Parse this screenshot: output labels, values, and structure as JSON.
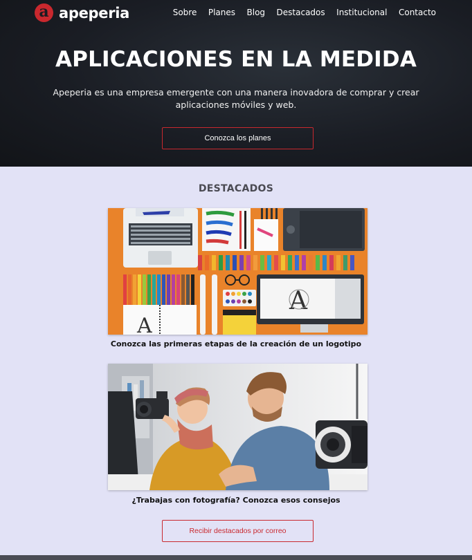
{
  "brand": {
    "name": "apeperia",
    "mark": "a",
    "accent": "#c9282e"
  },
  "nav": {
    "items": [
      {
        "label": "Sobre"
      },
      {
        "label": "Planes"
      },
      {
        "label": "Blog"
      },
      {
        "label": "Destacados"
      },
      {
        "label": "Institucional"
      },
      {
        "label": "Contacto"
      }
    ]
  },
  "hero": {
    "title": "APLICACIONES EN LA MEDIDA",
    "subtitle": "Apeperia es una empresa emergente con una manera inovadora de comprar y crear aplicaciones móviles y web.",
    "cta_label": "Conozca los planes"
  },
  "featured": {
    "title": "DESTACADOS",
    "cards": [
      {
        "caption": "Conozca las primeras etapas de la creación de un logotipo",
        "image": "design-tools-flatlay-illustration"
      },
      {
        "caption": "¿Trabajas con fotografía? Conozca esos consejos",
        "image": "photographers-with-camera-photo"
      }
    ],
    "subscribe_label": "Recibir destacados por correo"
  }
}
